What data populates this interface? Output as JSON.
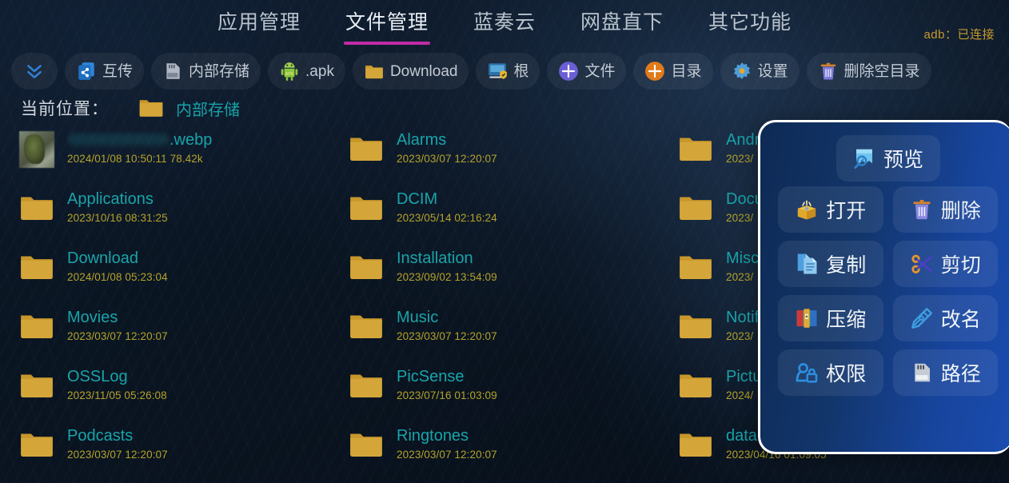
{
  "header": {
    "tabs": [
      {
        "label": "应用管理",
        "active": false
      },
      {
        "label": "文件管理",
        "active": true
      },
      {
        "label": "蓝奏云",
        "active": false
      },
      {
        "label": "网盘直下",
        "active": false
      },
      {
        "label": "其它功能",
        "active": false
      }
    ],
    "adb_status": "adb：已连接",
    "accent_underline": "#c22ba6"
  },
  "toolbar": {
    "buttons": [
      {
        "label": "",
        "icon": "double-chevron-down-icon"
      },
      {
        "label": "互传",
        "icon": "share-transfer-icon"
      },
      {
        "label": "内部存储",
        "icon": "sdcard-icon"
      },
      {
        "label": ".apk",
        "icon": "android-apk-icon"
      },
      {
        "label": "Download",
        "icon": "folder-icon"
      },
      {
        "label": "根",
        "icon": "root-monitor-icon"
      },
      {
        "label": "文件",
        "icon": "plus-circle-purple-icon"
      },
      {
        "label": "目录",
        "icon": "plus-circle-orange-icon"
      },
      {
        "label": "设置",
        "icon": "gear-icon"
      },
      {
        "label": "删除空目录",
        "icon": "trash-icon"
      }
    ]
  },
  "location": {
    "label": "当前位置：",
    "icon": "folder-icon",
    "path_name": "内部存储"
  },
  "files": {
    "col1": [
      {
        "name": "",
        "suffix": ".webp",
        "redacted": true,
        "meta": "2024/01/08 10:50:11  78.42k",
        "icon": "image-thumbnail"
      },
      {
        "name": "Applications",
        "suffix": "",
        "redacted": false,
        "meta": "2023/10/16 08:31:25",
        "icon": "folder-icon"
      },
      {
        "name": "Download",
        "suffix": "",
        "redacted": false,
        "meta": "2024/01/08 05:23:04",
        "icon": "folder-icon"
      },
      {
        "name": "Movies",
        "suffix": "",
        "redacted": false,
        "meta": "2023/03/07 12:20:07",
        "icon": "folder-icon"
      },
      {
        "name": "OSSLog",
        "suffix": "",
        "redacted": false,
        "meta": "2023/11/05 05:26:08",
        "icon": "folder-icon"
      },
      {
        "name": "Podcasts",
        "suffix": "",
        "redacted": false,
        "meta": "2023/03/07 12:20:07",
        "icon": "folder-icon"
      }
    ],
    "col2": [
      {
        "name": "Alarms",
        "suffix": "",
        "redacted": false,
        "meta": "2023/03/07 12:20:07",
        "icon": "folder-icon"
      },
      {
        "name": "DCIM",
        "suffix": "",
        "redacted": false,
        "meta": "2023/05/14 02:16:24",
        "icon": "folder-icon"
      },
      {
        "name": "Installation",
        "suffix": "",
        "redacted": false,
        "meta": "2023/09/02 13:54:09",
        "icon": "folder-icon"
      },
      {
        "name": "Music",
        "suffix": "",
        "redacted": false,
        "meta": "2023/03/07 12:20:07",
        "icon": "folder-icon"
      },
      {
        "name": "PicSense",
        "suffix": "",
        "redacted": false,
        "meta": "2023/07/16 01:03:09",
        "icon": "folder-icon"
      },
      {
        "name": "Ringtones",
        "suffix": "",
        "redacted": false,
        "meta": "2023/03/07 12:20:07",
        "icon": "folder-icon"
      }
    ],
    "col3": [
      {
        "name": "Andr",
        "suffix": "",
        "redacted": false,
        "meta": "2023/",
        "icon": "folder-icon"
      },
      {
        "name": "Docu",
        "suffix": "",
        "redacted": false,
        "meta": "2023/",
        "icon": "folder-icon"
      },
      {
        "name": "Misc",
        "suffix": "",
        "redacted": false,
        "meta": "2023/",
        "icon": "folder-icon"
      },
      {
        "name": "Notif",
        "suffix": "",
        "redacted": false,
        "meta": "2023/",
        "icon": "folder-icon"
      },
      {
        "name": "Pictu",
        "suffix": "",
        "redacted": false,
        "meta": "2024/",
        "icon": "folder-icon"
      },
      {
        "name": "data",
        "suffix": "",
        "redacted": false,
        "meta": "2023/04/16 01:09:05",
        "icon": "folder-icon"
      }
    ]
  },
  "context_menu": {
    "preview": {
      "label": "预览",
      "icon": "preview-magnifier-icon"
    },
    "items": [
      {
        "label": "打开",
        "icon": "open-box-icon"
      },
      {
        "label": "删除",
        "icon": "trash-icon"
      },
      {
        "label": "复制",
        "icon": "copy-document-icon"
      },
      {
        "label": "剪切",
        "icon": "scissors-icon"
      },
      {
        "label": "压缩",
        "icon": "archive-compress-icon"
      },
      {
        "label": "改名",
        "icon": "rename-pen-icon"
      },
      {
        "label": "权限",
        "icon": "permissions-key-icon"
      },
      {
        "label": "路径",
        "icon": "path-sdcard-icon"
      }
    ]
  }
}
